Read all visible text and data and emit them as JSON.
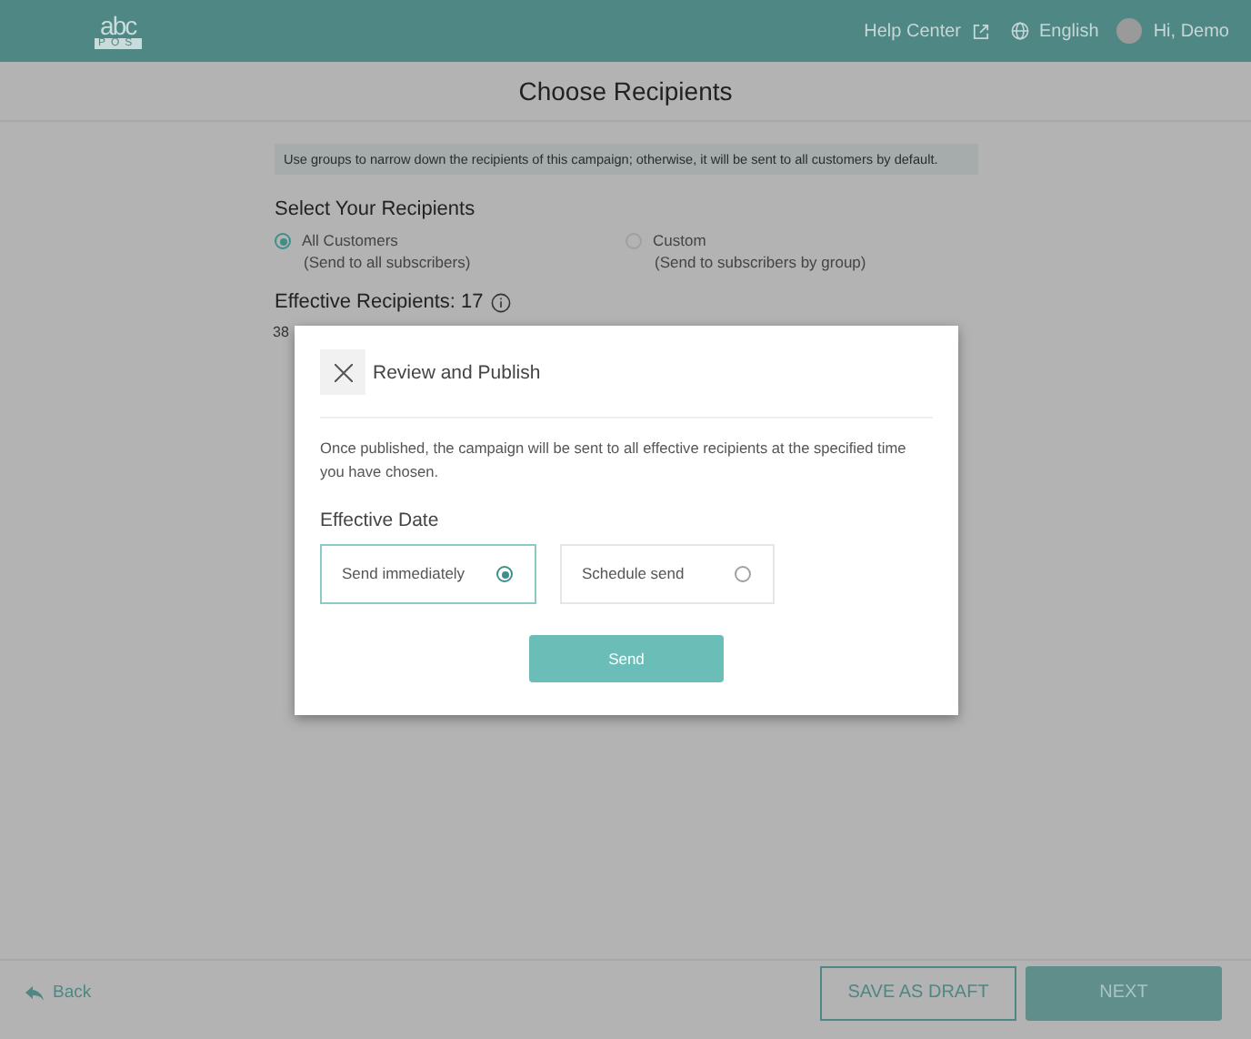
{
  "header": {
    "logo": {
      "top": "abc",
      "bottom": "POS"
    },
    "help": "Help Center",
    "language": "English",
    "greeting": "Hi, Demo"
  },
  "page_title": "Choose Recipients",
  "notice": "Use groups to narrow down the recipients of this campaign; otherwise, it will be sent to all customers by default.",
  "section_title": "Select Your Recipients",
  "options": [
    {
      "label": "All Customers",
      "note": "(Send to all subscribers)",
      "selected": true
    },
    {
      "label": "Custom",
      "note": "(Send to subscribers by group)",
      "selected": false
    }
  ],
  "effective": "Effective Recipients: 17",
  "partial_text": "38",
  "modal": {
    "title": "Review and Publish",
    "message": "Once published, the campaign will be sent to all effective recipients at the specified time you have chosen.",
    "date_label": "Effective Date",
    "choices": [
      {
        "label": "Send immediately",
        "selected": true
      },
      {
        "label": "Schedule send",
        "selected": false
      }
    ],
    "button": "Send"
  },
  "footer": {
    "back": "Back",
    "draft": "SAVE AS DRAFT",
    "next": "NEXT"
  }
}
